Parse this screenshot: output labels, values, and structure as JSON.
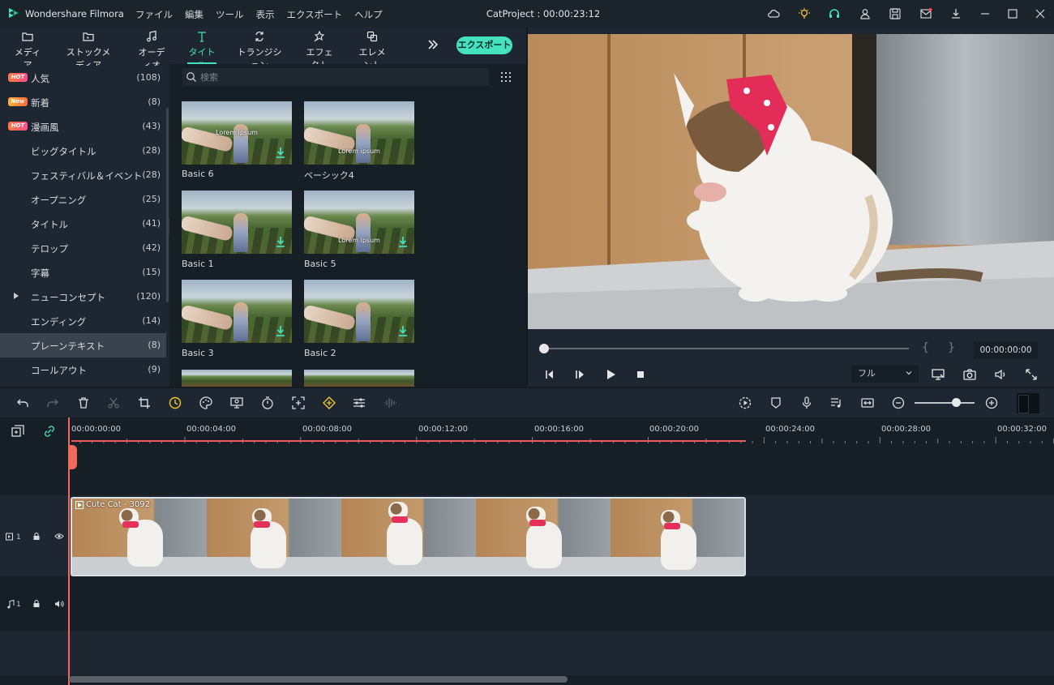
{
  "app": {
    "name": "Wondershare Filmora",
    "project_title": "CatProject : 00:00:23:12",
    "menu": [
      "ファイル",
      "編集",
      "ツール",
      "表示",
      "エクスポート",
      "ヘルプ"
    ]
  },
  "tabs": [
    {
      "label": "メディア",
      "icon": "folder-icon"
    },
    {
      "label": "ストックメディア",
      "icon": "stock-media-icon"
    },
    {
      "label": "オーディオ",
      "icon": "music-note-icon"
    },
    {
      "label": "タイトル",
      "icon": "title-t-icon",
      "active": true
    },
    {
      "label": "トランジション",
      "icon": "transition-icon"
    },
    {
      "label": "エフェクト",
      "icon": "effect-icon"
    },
    {
      "label": "エレメント",
      "icon": "element-icon"
    }
  ],
  "export_label": "エクスポート",
  "categories": [
    {
      "badge": "HOT",
      "label": "人気",
      "count": "(108)"
    },
    {
      "badge": "New",
      "label": "新着",
      "count": "(8)"
    },
    {
      "badge": "HOT",
      "label": "漫画風",
      "count": "(43)"
    },
    {
      "badge": "",
      "label": "ビッグタイトル",
      "count": "(28)"
    },
    {
      "badge": "",
      "label": "フェスティバル＆イベント",
      "count": "(28)"
    },
    {
      "badge": "",
      "label": "オープニング",
      "count": "(25)"
    },
    {
      "badge": "",
      "label": "タイトル",
      "count": "(41)"
    },
    {
      "badge": "",
      "label": "テロップ",
      "count": "(42)"
    },
    {
      "badge": "",
      "label": "字幕",
      "count": "(15)"
    },
    {
      "badge": "",
      "label": "ニューコンセプト",
      "count": "(120)",
      "expandable": true
    },
    {
      "badge": "",
      "label": "エンディング",
      "count": "(14)"
    },
    {
      "badge": "",
      "label": "プレーンテキスト",
      "count": "(8)",
      "selected": true
    },
    {
      "badge": "",
      "label": "コールアウト",
      "count": "(9)"
    }
  ],
  "search": {
    "placeholder": "検索"
  },
  "thumbnails": [
    {
      "label": "Basic 6",
      "overlay": "Lorem ipsum"
    },
    {
      "label": "ベーシック4",
      "overlay": "Lorem ipsum"
    },
    {
      "label": "Basic 1",
      "overlay": ""
    },
    {
      "label": "Basic 5",
      "overlay": "Lorem ipsum"
    },
    {
      "label": "Basic 3",
      "overlay": ""
    },
    {
      "label": "Basic 2",
      "overlay": ""
    }
  ],
  "player": {
    "timecode": "00:00:00:00",
    "quality": "フル",
    "brace_open": "{",
    "brace_close": "}"
  },
  "ruler": [
    "00:00:00:00",
    "00:00:04:00",
    "00:00:08:00",
    "00:00:12:00",
    "00:00:16:00",
    "00:00:20:00",
    "00:00:24:00",
    "00:00:28:00",
    "00:00:32:00"
  ],
  "tracks": {
    "video": {
      "number": "1"
    },
    "audio": {
      "number": "1"
    }
  },
  "clip": {
    "label": "Cute Cat - 3092"
  },
  "colors": {
    "accent": "#45e2c0",
    "playhead": "#f06a5c",
    "hot_badge": "#ff5a6a"
  }
}
